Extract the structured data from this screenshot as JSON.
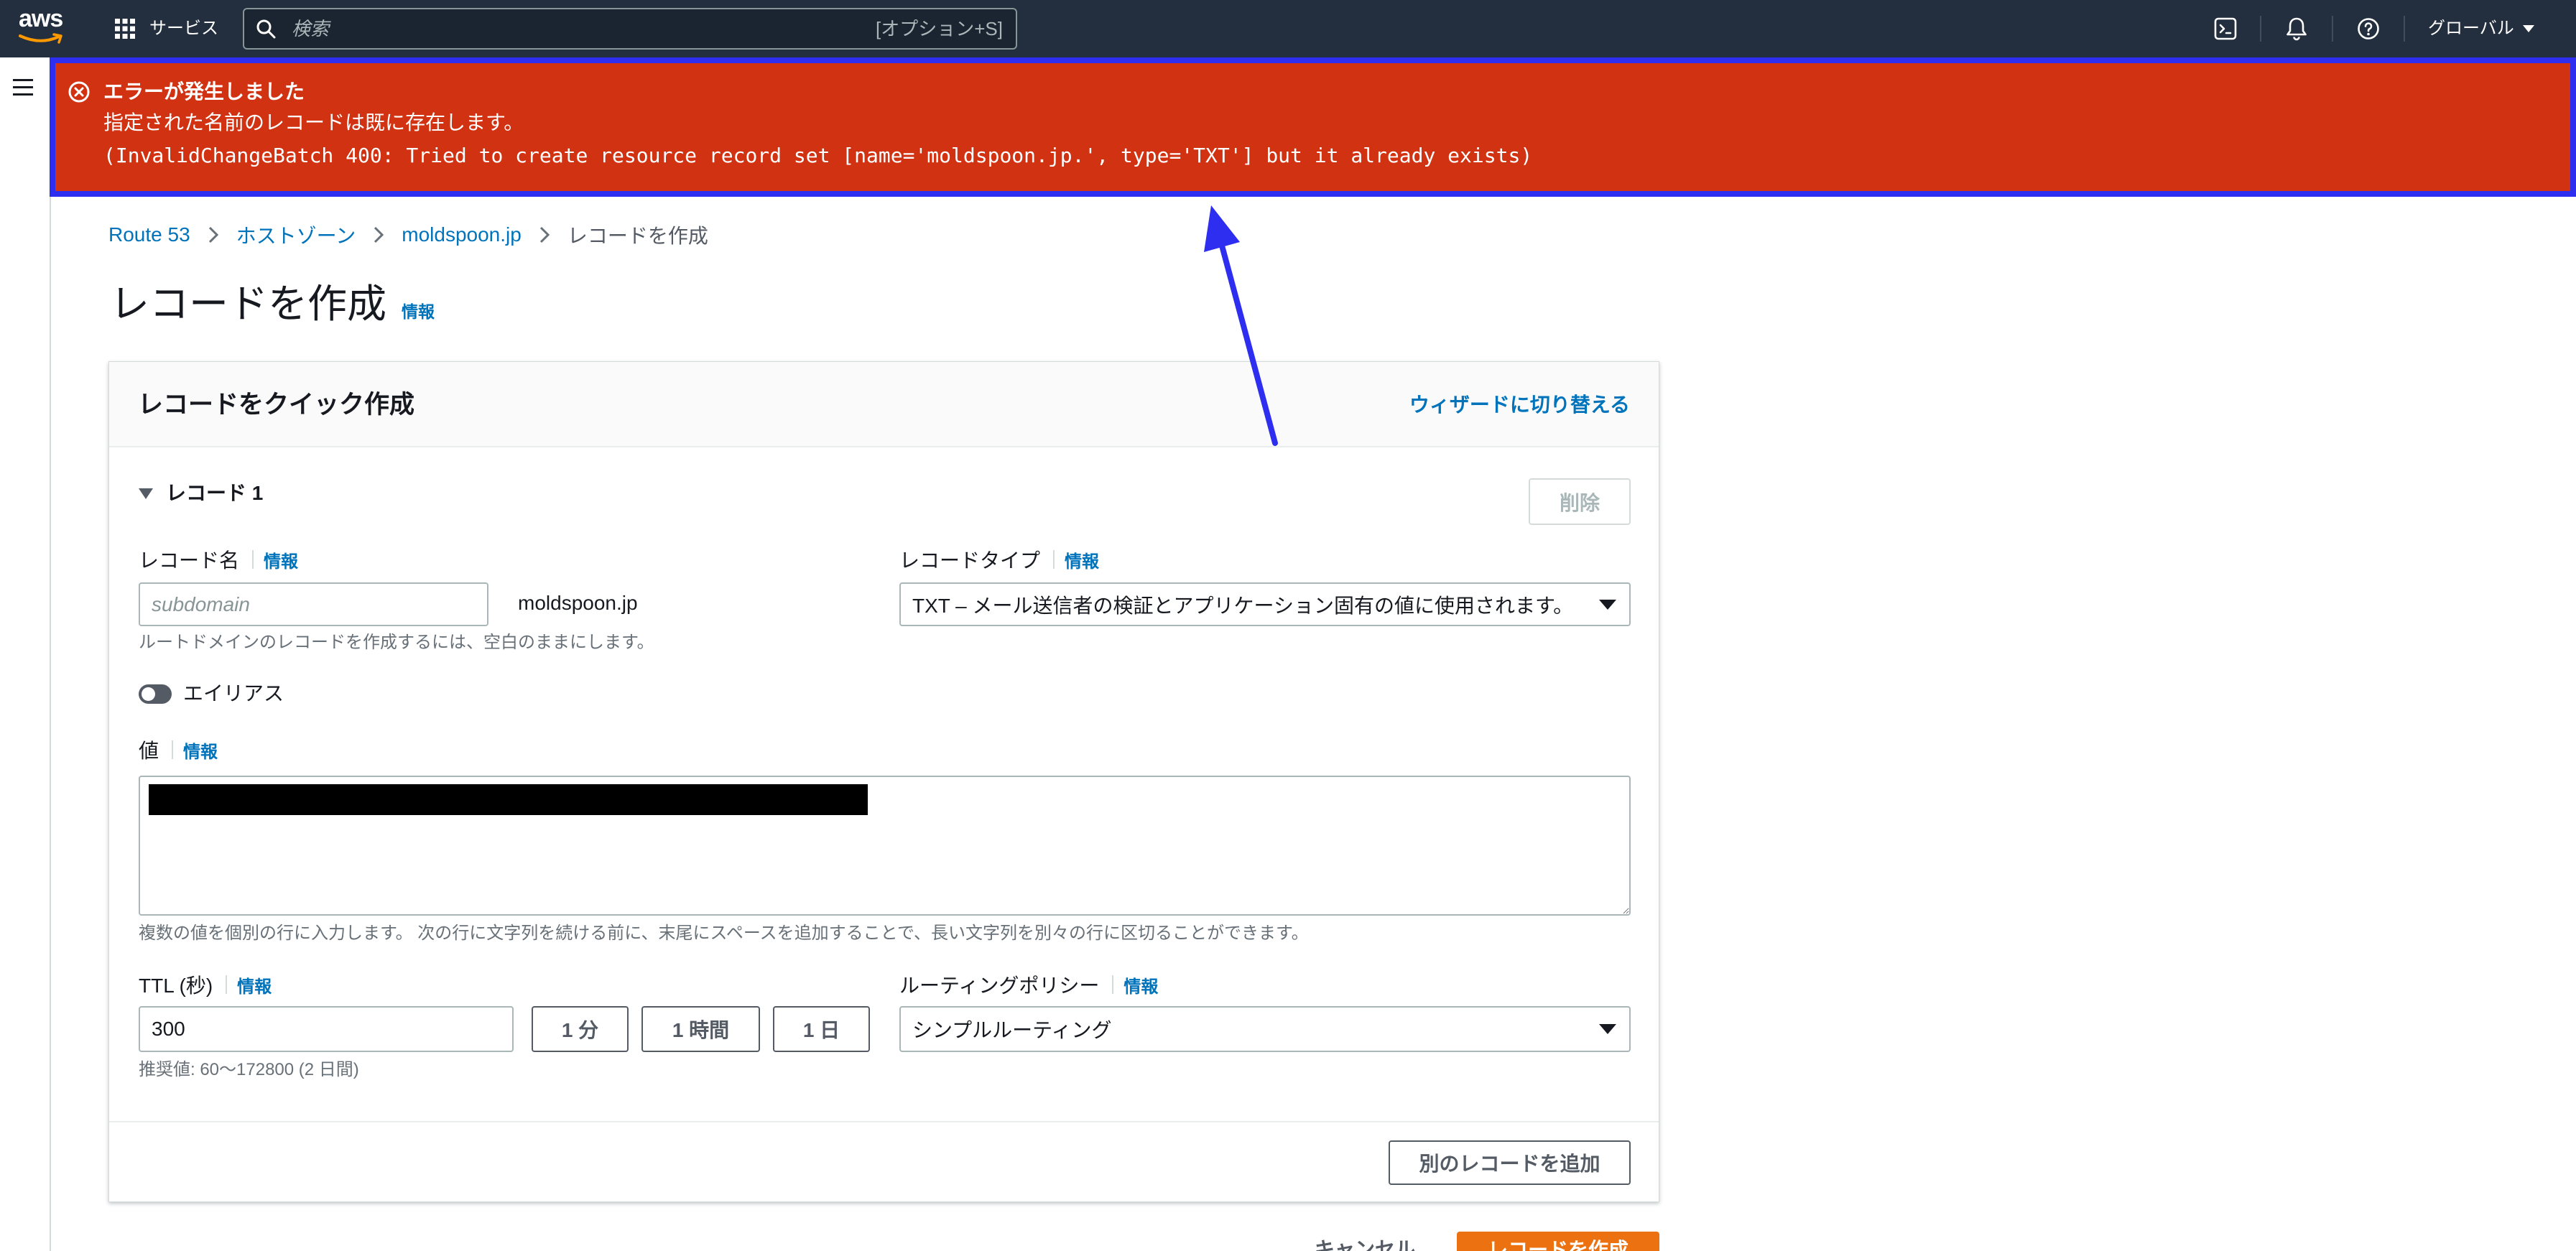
{
  "nav": {
    "logo_text": "aws",
    "services_label": "サービス",
    "search": {
      "placeholder": "検索",
      "shortcut": "[オプション+S]"
    },
    "region_label": "グローバル",
    "icons": {
      "services": "grid-icon",
      "search": "search-icon",
      "cloudshell": "terminal-icon",
      "notifications": "bell-icon",
      "help": "help-icon",
      "menu": "hamburger-icon"
    }
  },
  "error": {
    "icon": "error-circle-icon",
    "title": "エラーが発生しました",
    "message": "指定された名前のレコードは既に存在します。",
    "detail": "(InvalidChangeBatch 400: Tried to create resource record set [name='moldspoon.jp.', type='TXT'] but it already exists)"
  },
  "breadcrumb": [
    {
      "label": "Route 53"
    },
    {
      "label": "ホストゾーン"
    },
    {
      "label": "moldspoon.jp"
    },
    {
      "label": "レコードを作成"
    }
  ],
  "page": {
    "title": "レコードを作成",
    "info": "情報"
  },
  "card": {
    "title": "レコードをクイック作成",
    "wizard_link": "ウィザードに切り替える",
    "record": {
      "section_label": "レコード 1",
      "delete_label": "削除",
      "name": {
        "label": "レコード名",
        "info": "情報",
        "placeholder": "subdomain",
        "domain_suffix": "moldspoon.jp",
        "help": "ルートドメインのレコードを作成するには、空白のままにします。"
      },
      "type": {
        "label": "レコードタイプ",
        "info": "情報",
        "selected": "TXT – メール送信者の検証とアプリケーション固有の値に使用されます。"
      },
      "alias": {
        "label": "エイリアス",
        "enabled": false
      },
      "value": {
        "label": "値",
        "info": "情報",
        "help": "複数の値を個別の行に入力します。 次の行に文字列を続ける前に、末尾にスペースを追加することで、長い文字列を別々の行に区切ることができます。"
      },
      "ttl": {
        "label": "TTL (秒)",
        "info": "情報",
        "value": "300",
        "presets": [
          "1 分",
          "1 時間",
          "1 日"
        ],
        "recommendation": "推奨値: 60〜172800 (2 日間)"
      },
      "routing": {
        "label": "ルーティングポリシー",
        "info": "情報",
        "selected": "シンプルルーティング"
      }
    },
    "add_record_label": "別のレコードを追加"
  },
  "footer": {
    "cancel_label": "キャンセル",
    "submit_label": "レコードを作成"
  },
  "colors": {
    "nav": "#232f3e",
    "err": "#d13212",
    "ann": "#2e2ef0",
    "link": "#0073bb",
    "primary": "#ec7211",
    "text": "#16191f",
    "muted": "#687078",
    "btn": "#545b64",
    "border": "#aab7b8"
  }
}
